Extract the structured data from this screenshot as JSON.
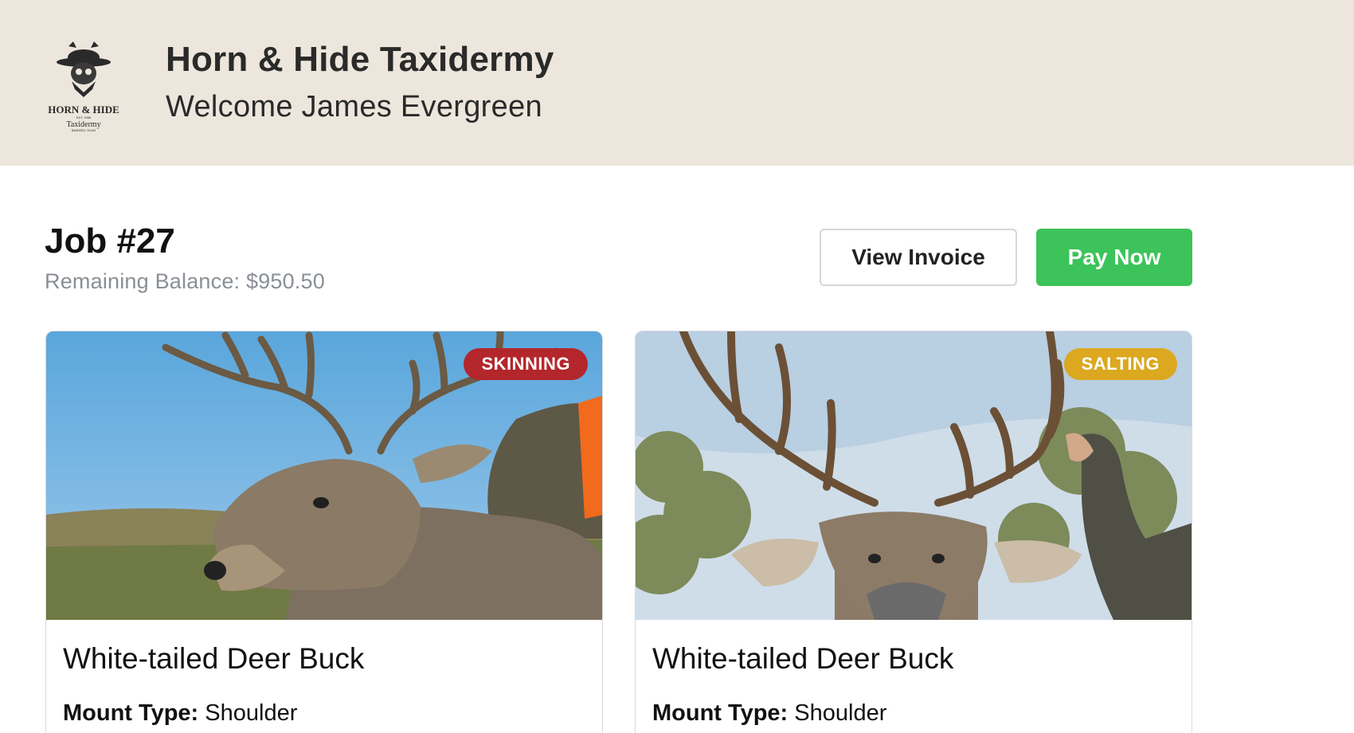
{
  "header": {
    "logo": {
      "icon": "skull-cowboy-logo-icon",
      "line1": "HORN & HIDE",
      "line2": "EST. 1989",
      "line3": "Taxidermy",
      "line4": "BANDERA, TEXAS"
    },
    "title": "Horn & Hide Taxidermy",
    "welcome": "Welcome James Evergreen"
  },
  "job": {
    "title": "Job #27",
    "balance": "Remaining Balance: $950.50"
  },
  "actions": {
    "view_invoice": "View Invoice",
    "pay_now": "Pay Now",
    "pay_color": "#3cc35a"
  },
  "cards": [
    {
      "photo": "deer-photo",
      "status": "SKINNING",
      "status_color": "#b3262b",
      "name": "White-tailed Deer Buck",
      "mount_label": "Mount Type:",
      "mount_value": "Shoulder"
    },
    {
      "photo": "deer-photo",
      "status": "SALTING",
      "status_color": "#dba820",
      "name": "White-tailed Deer Buck",
      "mount_label": "Mount Type:",
      "mount_value": "Shoulder"
    }
  ]
}
